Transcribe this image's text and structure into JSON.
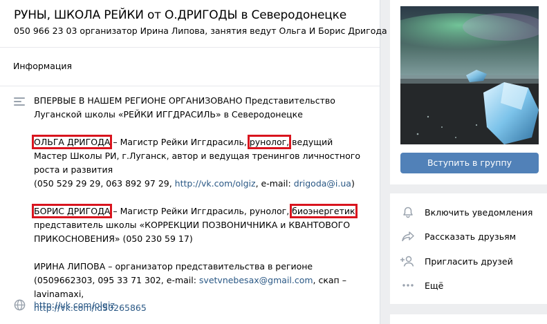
{
  "header": {
    "title": "РУНЫ, ШКОЛА РЕЙКИ от О.ДРИГОДЫ в Северодонецке",
    "subtitle": "050 966 23 03 организатор Ирина Липова, занятия ведут Ольга И Борис Дригода"
  },
  "info_tab": {
    "label": "Информация"
  },
  "description": {
    "p1": "ВПЕРВЫЕ В НАШЕМ РЕГИОНЕ ОРГАНИЗОВАНО Представительство Луганской школы «РЕЙКИ ИГГДРАСИЛЬ» в Северодонецке",
    "olga_name": "ОЛЬГА ДРИГОДА",
    "olga_text1": " – Магистр Рейки Иггдрасиль, ",
    "olga_runolog": "рунолог,",
    "olga_text2": " ведущий Мастер Школы РИ, г.Луганск, автор и ведущая тренингов личностного роста и развития",
    "olga_phones": "(050 529 29 29, 063 892 97 29, ",
    "olga_vk": "http://vk.com/olgiz",
    "olga_email_label": ", e-mail: ",
    "olga_email": "drigoda@i.ua",
    "olga_close": ")",
    "boris_name": "БОРИС ДРИГОДА",
    "boris_text1": " – Магистр Рейки Иггдрасиль, рунолог, ",
    "boris_bio": "биоэнергетик",
    "boris_text2": " представитель школы «КОРРЕКЦИИ ПОЗВОНИЧНИКА и КВАНТОВОГО ПРИКОСНОВЕНИЯ» (050 230 59 17)",
    "irina_text1": "ИРИНА ЛИПОВА – организатор представительства в регионе (0509662303, 095 33 71 302, e-mail: ",
    "irina_email": "svetvnebesax@gmail.com",
    "irina_text2": ", скап –lavinamaxi,",
    "irina_vk": "http://vk.com/id50265865"
  },
  "link": {
    "url": "http://vk.com/olgiz"
  },
  "sidebar": {
    "join_label": "Вступить в группу",
    "actions": [
      {
        "label": "Включить уведомления",
        "icon": "bell-icon"
      },
      {
        "label": "Рассказать друзьям",
        "icon": "share-arrow-icon"
      },
      {
        "label": "Пригласить друзей",
        "icon": "add-user-icon"
      },
      {
        "label": "Ещё",
        "icon": "more-dots-icon"
      }
    ]
  },
  "colors": {
    "link": "#2a5885",
    "button": "#5181b8",
    "highlight": "#d9141e",
    "icon": "#99a2ad"
  }
}
